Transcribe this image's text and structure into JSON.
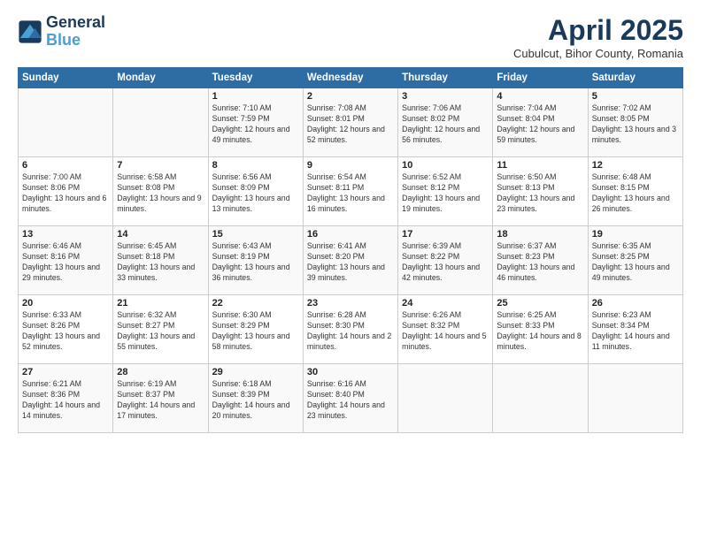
{
  "header": {
    "logo_line1": "General",
    "logo_line2": "Blue",
    "month": "April 2025",
    "location": "Cubulcut, Bihor County, Romania"
  },
  "days_of_week": [
    "Sunday",
    "Monday",
    "Tuesday",
    "Wednesday",
    "Thursday",
    "Friday",
    "Saturday"
  ],
  "weeks": [
    [
      {
        "num": "",
        "info": ""
      },
      {
        "num": "",
        "info": ""
      },
      {
        "num": "1",
        "info": "Sunrise: 7:10 AM\nSunset: 7:59 PM\nDaylight: 12 hours and 49 minutes."
      },
      {
        "num": "2",
        "info": "Sunrise: 7:08 AM\nSunset: 8:01 PM\nDaylight: 12 hours and 52 minutes."
      },
      {
        "num": "3",
        "info": "Sunrise: 7:06 AM\nSunset: 8:02 PM\nDaylight: 12 hours and 56 minutes."
      },
      {
        "num": "4",
        "info": "Sunrise: 7:04 AM\nSunset: 8:04 PM\nDaylight: 12 hours and 59 minutes."
      },
      {
        "num": "5",
        "info": "Sunrise: 7:02 AM\nSunset: 8:05 PM\nDaylight: 13 hours and 3 minutes."
      }
    ],
    [
      {
        "num": "6",
        "info": "Sunrise: 7:00 AM\nSunset: 8:06 PM\nDaylight: 13 hours and 6 minutes."
      },
      {
        "num": "7",
        "info": "Sunrise: 6:58 AM\nSunset: 8:08 PM\nDaylight: 13 hours and 9 minutes."
      },
      {
        "num": "8",
        "info": "Sunrise: 6:56 AM\nSunset: 8:09 PM\nDaylight: 13 hours and 13 minutes."
      },
      {
        "num": "9",
        "info": "Sunrise: 6:54 AM\nSunset: 8:11 PM\nDaylight: 13 hours and 16 minutes."
      },
      {
        "num": "10",
        "info": "Sunrise: 6:52 AM\nSunset: 8:12 PM\nDaylight: 13 hours and 19 minutes."
      },
      {
        "num": "11",
        "info": "Sunrise: 6:50 AM\nSunset: 8:13 PM\nDaylight: 13 hours and 23 minutes."
      },
      {
        "num": "12",
        "info": "Sunrise: 6:48 AM\nSunset: 8:15 PM\nDaylight: 13 hours and 26 minutes."
      }
    ],
    [
      {
        "num": "13",
        "info": "Sunrise: 6:46 AM\nSunset: 8:16 PM\nDaylight: 13 hours and 29 minutes."
      },
      {
        "num": "14",
        "info": "Sunrise: 6:45 AM\nSunset: 8:18 PM\nDaylight: 13 hours and 33 minutes."
      },
      {
        "num": "15",
        "info": "Sunrise: 6:43 AM\nSunset: 8:19 PM\nDaylight: 13 hours and 36 minutes."
      },
      {
        "num": "16",
        "info": "Sunrise: 6:41 AM\nSunset: 8:20 PM\nDaylight: 13 hours and 39 minutes."
      },
      {
        "num": "17",
        "info": "Sunrise: 6:39 AM\nSunset: 8:22 PM\nDaylight: 13 hours and 42 minutes."
      },
      {
        "num": "18",
        "info": "Sunrise: 6:37 AM\nSunset: 8:23 PM\nDaylight: 13 hours and 46 minutes."
      },
      {
        "num": "19",
        "info": "Sunrise: 6:35 AM\nSunset: 8:25 PM\nDaylight: 13 hours and 49 minutes."
      }
    ],
    [
      {
        "num": "20",
        "info": "Sunrise: 6:33 AM\nSunset: 8:26 PM\nDaylight: 13 hours and 52 minutes."
      },
      {
        "num": "21",
        "info": "Sunrise: 6:32 AM\nSunset: 8:27 PM\nDaylight: 13 hours and 55 minutes."
      },
      {
        "num": "22",
        "info": "Sunrise: 6:30 AM\nSunset: 8:29 PM\nDaylight: 13 hours and 58 minutes."
      },
      {
        "num": "23",
        "info": "Sunrise: 6:28 AM\nSunset: 8:30 PM\nDaylight: 14 hours and 2 minutes."
      },
      {
        "num": "24",
        "info": "Sunrise: 6:26 AM\nSunset: 8:32 PM\nDaylight: 14 hours and 5 minutes."
      },
      {
        "num": "25",
        "info": "Sunrise: 6:25 AM\nSunset: 8:33 PM\nDaylight: 14 hours and 8 minutes."
      },
      {
        "num": "26",
        "info": "Sunrise: 6:23 AM\nSunset: 8:34 PM\nDaylight: 14 hours and 11 minutes."
      }
    ],
    [
      {
        "num": "27",
        "info": "Sunrise: 6:21 AM\nSunset: 8:36 PM\nDaylight: 14 hours and 14 minutes."
      },
      {
        "num": "28",
        "info": "Sunrise: 6:19 AM\nSunset: 8:37 PM\nDaylight: 14 hours and 17 minutes."
      },
      {
        "num": "29",
        "info": "Sunrise: 6:18 AM\nSunset: 8:39 PM\nDaylight: 14 hours and 20 minutes."
      },
      {
        "num": "30",
        "info": "Sunrise: 6:16 AM\nSunset: 8:40 PM\nDaylight: 14 hours and 23 minutes."
      },
      {
        "num": "",
        "info": ""
      },
      {
        "num": "",
        "info": ""
      },
      {
        "num": "",
        "info": ""
      }
    ]
  ]
}
